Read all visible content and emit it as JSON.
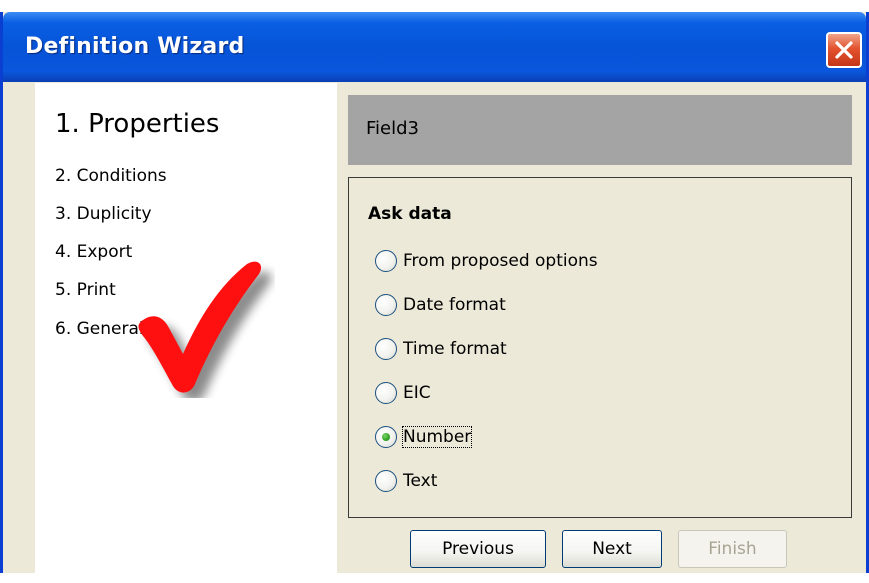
{
  "window": {
    "title": "Definition Wizard"
  },
  "steps": {
    "current": "1. Properties",
    "items": [
      "2. Conditions",
      "3. Duplicity",
      "4. Export",
      "5. Print",
      "6. General"
    ]
  },
  "field": {
    "name": "Field3"
  },
  "ask_data": {
    "label": "Ask data",
    "options": [
      {
        "label": "From proposed options",
        "selected": false
      },
      {
        "label": "Date format",
        "selected": false
      },
      {
        "label": "Time format",
        "selected": false
      },
      {
        "label": "EIC",
        "selected": false
      },
      {
        "label": "Number",
        "selected": true
      },
      {
        "label": "Text",
        "selected": false
      }
    ]
  },
  "buttons": {
    "previous": "Previous",
    "next": "Next",
    "finish": "Finish"
  },
  "icons": {
    "close": "close-icon",
    "check": "checkmark-icon"
  },
  "colors": {
    "titlebar": "#0654d8",
    "header_strip": "#a4a4a4",
    "checkmark": "#ff0000",
    "radio_dot": "#2a9a1a"
  }
}
